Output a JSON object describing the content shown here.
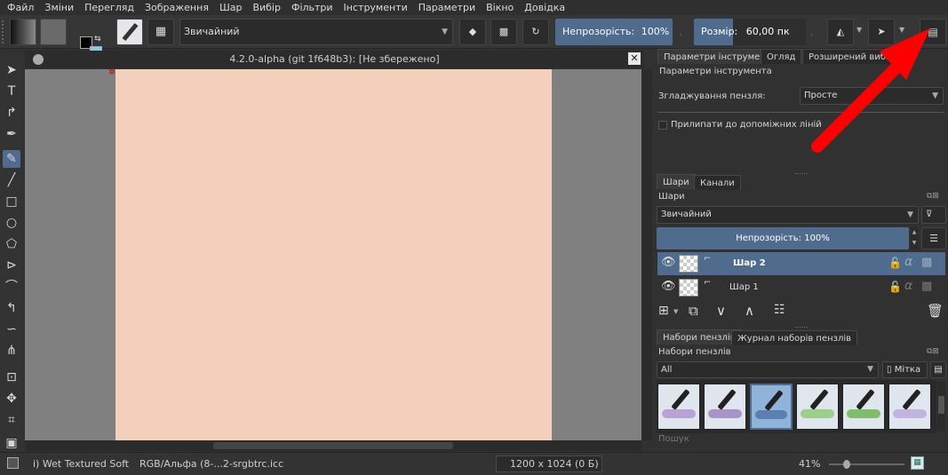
{
  "menu": [
    "Файл",
    "Зміни",
    "Перегляд",
    "Зображення",
    "Шар",
    "Вибір",
    "Фільтри",
    "Інструменти",
    "Параметри",
    "Вікно",
    "Довідка"
  ],
  "toolbar": {
    "blend_mode": "Звичайний",
    "opacity_label": "Непрозорість:",
    "opacity_value": "100%",
    "size_label": "Розмір:",
    "size_value": "60,00 пк",
    "opacity_fraction": 1.0,
    "size_fraction": 0.35,
    "colors": {
      "foreground": "#000000",
      "background": "#ffffff",
      "accent": "#4f6c8e"
    }
  },
  "document": {
    "title": "4.2.0-alpha (git 1f648b3):  [Не збережено]",
    "canvas_color": "#f2d0bc"
  },
  "tool_options": {
    "tabs": [
      "Параметри інструмента",
      "Огляд",
      "Розширений вибі..."
    ],
    "title": "Параметри інструмента",
    "smoothing_label": "Згладжування пензля:",
    "smoothing_value": "Просте",
    "snap_label": "Прилипати до допоміжних ліній"
  },
  "layers": {
    "tabs": [
      "Шари",
      "Канали"
    ],
    "title": "Шари",
    "blend_mode": "Звичайний",
    "opacity_text": "Непрозорість:  100%",
    "items": [
      {
        "name": "Шар 2",
        "selected": true
      },
      {
        "name": "Шар 1",
        "selected": false
      }
    ]
  },
  "brushes": {
    "tabs": [
      "Набори пензлів",
      "Журнал наборів пензлів"
    ],
    "title": "Набори пензлів",
    "filter": "All",
    "tag_label": "Мітка",
    "search_placeholder": "Пошук",
    "presets": [
      {
        "stroke_color": "#b9a3d6"
      },
      {
        "stroke_color": "#a894c9"
      },
      {
        "stroke_color": "#5b7fb3"
      },
      {
        "stroke_color": "#9ccf8c"
      },
      {
        "stroke_color": "#7fbf6a"
      },
      {
        "stroke_color": "#c2b3e0"
      }
    ]
  },
  "status": {
    "brush": "i) Wet Textured Soft",
    "color_profile": "RGB/Альфа (8-...2-srgbtrc.icc",
    "image_size": "1200 x 1024 (0 Б)",
    "zoom": "41%"
  }
}
